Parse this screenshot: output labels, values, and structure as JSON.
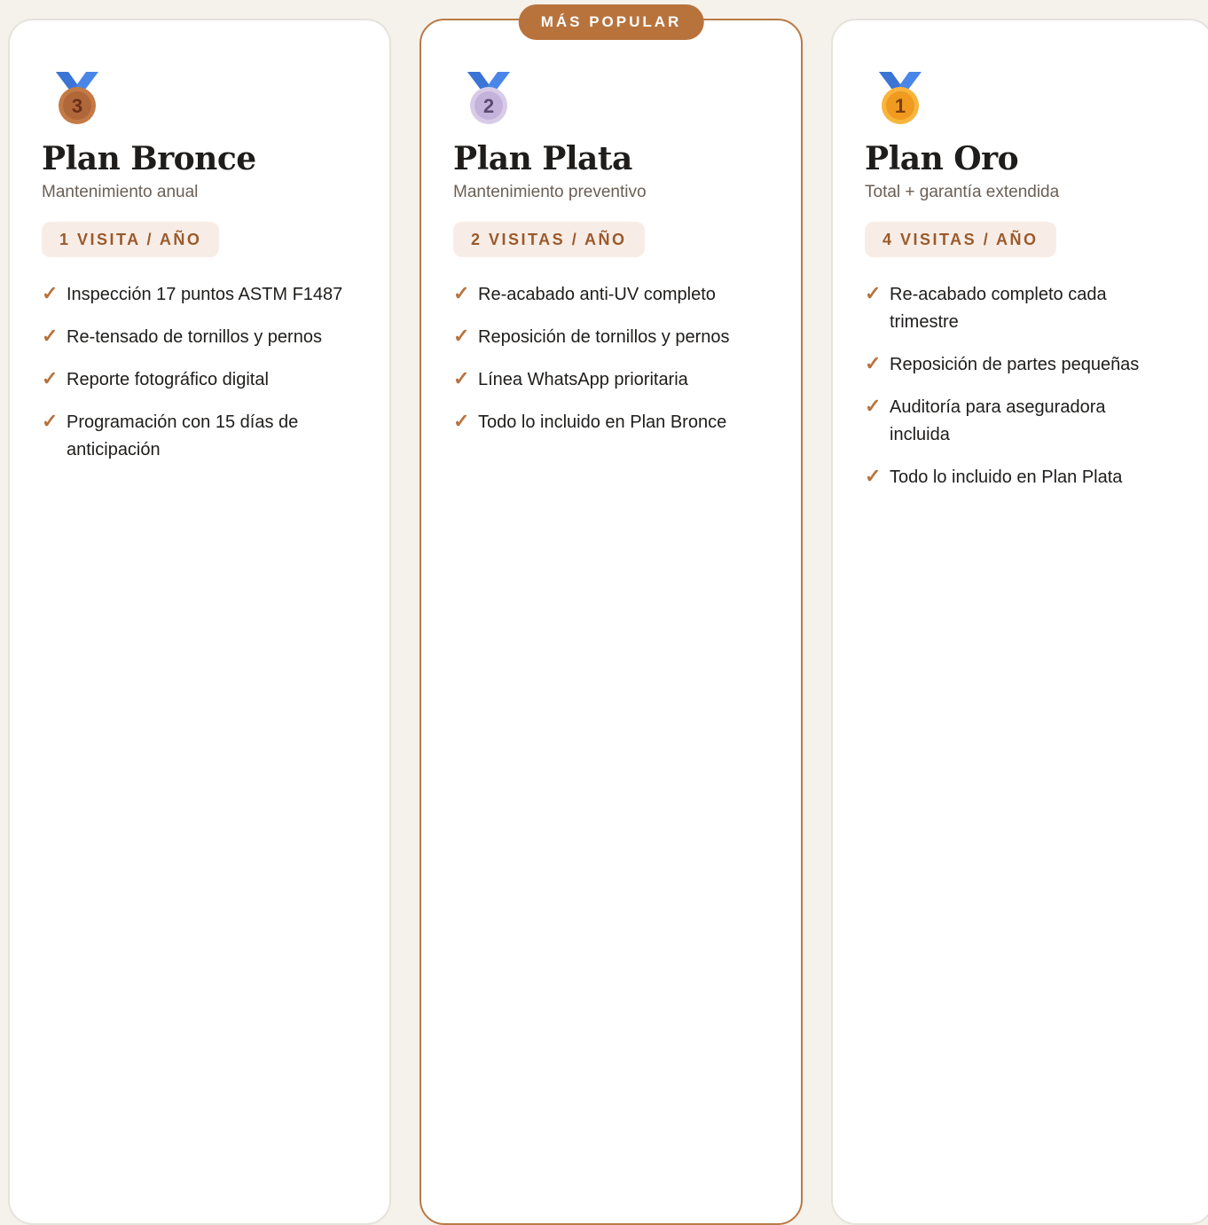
{
  "popular_badge": "MÁS POPULAR",
  "plans": [
    {
      "id": "bronce",
      "medal_icon": "third-place-medal-icon",
      "medal_number": "3",
      "title": "Plan Bronce",
      "subtitle": "Mantenimiento anual",
      "visits": "1 VISITA / AÑO",
      "features": [
        "Inspección 17 puntos ASTM F1487",
        "Re-tensado de tornillos y pernos",
        "Reporte fotográfico digital",
        "Programación con 15 días de anticipación"
      ]
    },
    {
      "id": "plata",
      "medal_icon": "second-place-medal-icon",
      "medal_number": "2",
      "title": "Plan Plata",
      "subtitle": "Mantenimiento preventivo",
      "visits": "2 VISITAS / AÑO",
      "features": [
        "Re-acabado anti-UV completo",
        "Reposición de tornillos y pernos",
        "Línea WhatsApp prioritaria",
        "Todo lo incluido en Plan Bronce"
      ]
    },
    {
      "id": "oro",
      "medal_icon": "first-place-medal-icon",
      "medal_number": "1",
      "title": "Plan Oro",
      "subtitle": "Total + garantía extendida",
      "visits": "4 VISITAS / AÑO",
      "features": [
        "Re-acabado completo cada trimestre",
        "Reposición de partes pequeñas",
        "Auditoría para aseguradora incluida",
        "Todo lo incluido en Plan Plata"
      ]
    }
  ],
  "check_glyph": "✓",
  "colors": {
    "accent": "#b8733d",
    "ribbon": "#4a86e8",
    "bronze": "#c47a45",
    "silver": "#c9b8dd",
    "gold": "#f4a52c",
    "page_bg": "#f5f1eb"
  }
}
